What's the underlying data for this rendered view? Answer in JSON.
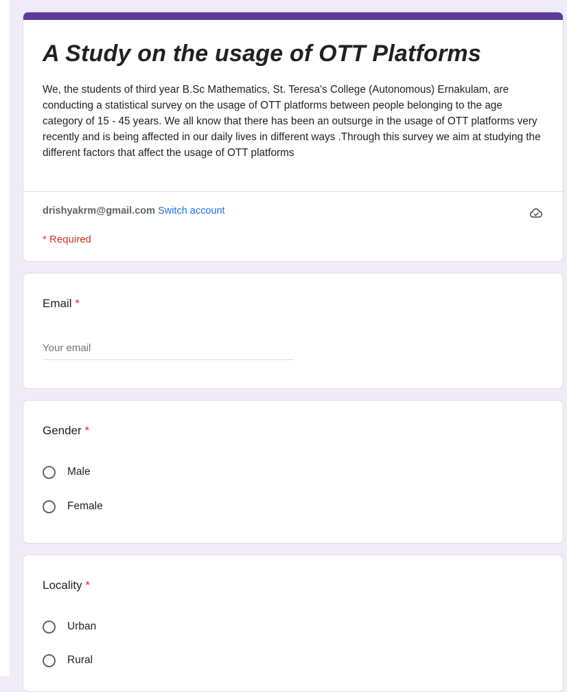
{
  "header": {
    "title": "A Study on the usage of OTT Platforms",
    "description": "We, the students of third year B.Sc Mathematics, St. Teresa's College (Autonomous) Ernakulam, are conducting a statistical survey on the usage of OTT platforms between people belonging to the age category of 15 - 45 years. We all know that there has been an outsurge in the usage of OTT platforms very recently and is being affected in our daily lives in different ways .Through this survey we aim at studying the different factors that affect the usage of OTT platforms",
    "account_email": "drishyakrm@gmail.com",
    "switch_account_label": "Switch account",
    "required_note": "* Required",
    "cloud_icon": "cloud-saved-icon",
    "accent_color": "#5b3a9e"
  },
  "questions": {
    "email": {
      "label": "Email",
      "required_marker": "*",
      "placeholder": "Your email",
      "value": ""
    },
    "gender": {
      "label": "Gender",
      "required_marker": "*",
      "options": [
        "Male",
        "Female"
      ]
    },
    "locality": {
      "label": "Locality",
      "required_marker": "*",
      "options": [
        "Urban",
        "Rural"
      ]
    }
  }
}
